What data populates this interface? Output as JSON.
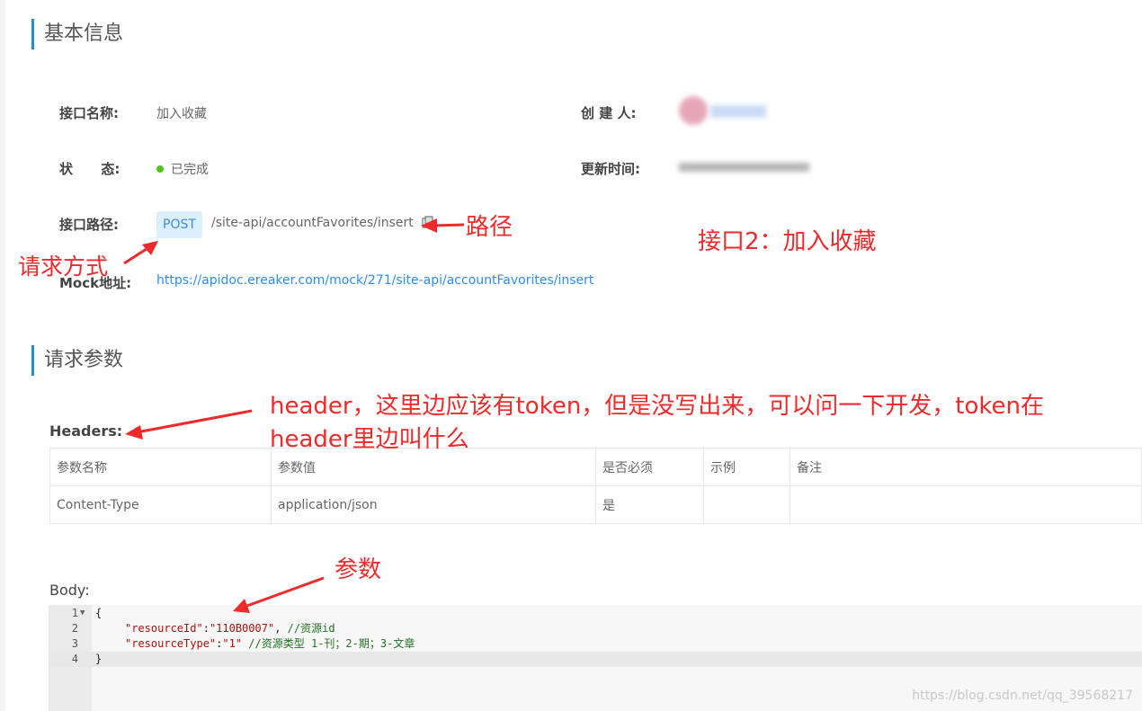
{
  "sections": {
    "basic_info": "基本信息",
    "request_params": "请求参数"
  },
  "info": {
    "name_label": "接口名称:",
    "name_value": "加入收藏",
    "creator_label": "创 建 人:",
    "status_label": "状      态:",
    "status_value": "已完成",
    "updated_label": "更新时间:",
    "path_label": "接口路径:",
    "method": "POST",
    "path": "/site-api/accountFavorites/insert",
    "mock_label": "Mock地址:",
    "mock_url": "https://apidoc.ereaker.com/mock/271/site-api/accountFavorites/insert"
  },
  "annotations": {
    "path": "路径",
    "method": "请求方式",
    "api": "接口2：加入收藏",
    "header_line1": "header，这里边应该有token，但是没写出来，可以问一下开发，token在",
    "header_line2": "header里边叫什么",
    "params": "参数"
  },
  "headers": {
    "label": "Headers:",
    "columns": [
      "参数名称",
      "参数值",
      "是否必须",
      "示例",
      "备注"
    ],
    "rows": [
      [
        "Content-Type",
        "application/json",
        "是",
        "",
        ""
      ]
    ]
  },
  "body": {
    "label": "Body:",
    "line_numbers": [
      "1",
      "2",
      "3",
      "4"
    ],
    "lines": {
      "l1": "{",
      "l2_key": "\"resourceId\"",
      "l2_colon": ":",
      "l2_val": "\"110B0007\"",
      "l2_comma": ", ",
      "l2_comment": "//资源id",
      "l3_key": "\"resourceType\"",
      "l3_colon": ":",
      "l3_val": "\"1\"",
      "l3_comment": " //资源类型 1-刊；2-期；3-文章",
      "l4": "}"
    }
  },
  "watermark": "https://blog.csdn.net/qq_39568217",
  "colors": {
    "accent": "#1c8de0",
    "annotation": "#ee2a2a",
    "status_green": "#52c41a",
    "link": "#2d8cf0"
  }
}
